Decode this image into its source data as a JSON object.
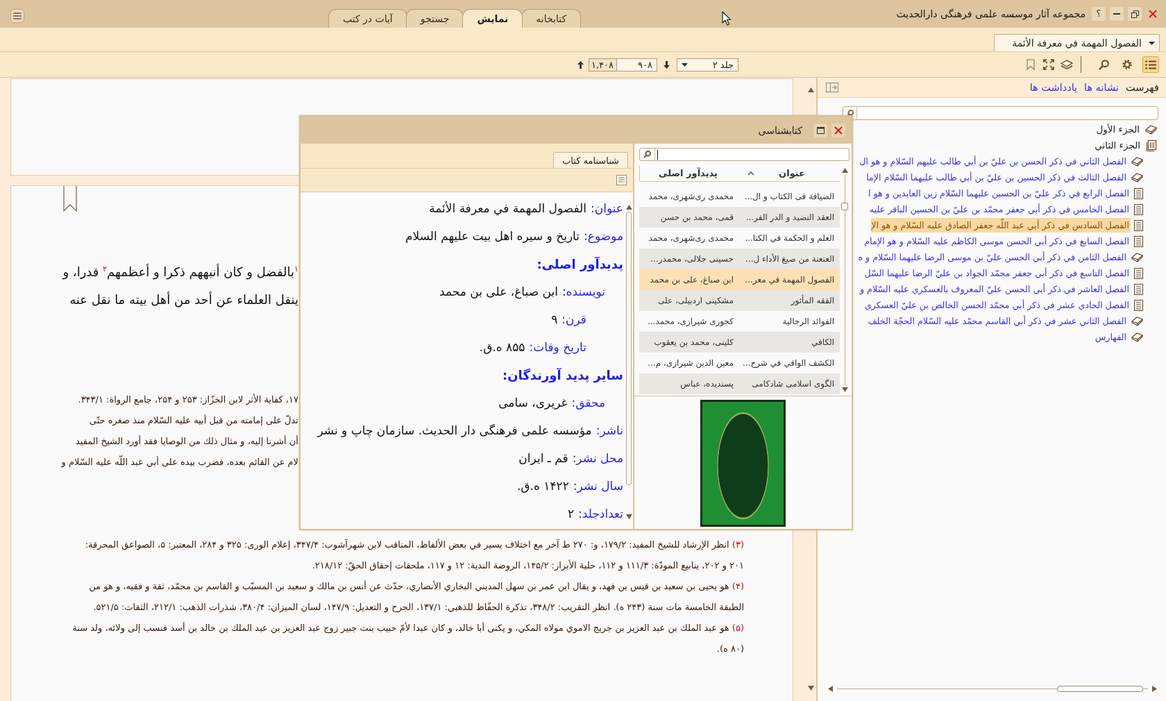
{
  "window": {
    "title": "مجموعه آثار موسسه علمی فرهنگی دارالحدیث",
    "help": "؟"
  },
  "ribbon_tabs": [
    {
      "label": "کتابخانه",
      "selected": false
    },
    {
      "label": "نمایش",
      "selected": true
    },
    {
      "label": "جستجو",
      "selected": false
    },
    {
      "label": "آیات در کتب",
      "selected": false
    }
  ],
  "book_selector": {
    "value": "الفصول المهمة في معرفة الأئمة"
  },
  "toolbar": {
    "tool_groups": [
      [
        {
          "kind": "contents",
          "on": true
        },
        {
          "kind": "settings",
          "on": false
        },
        {
          "kind": "search",
          "on": false
        }
      ],
      [
        {
          "kind": "books",
          "on": false
        },
        {
          "kind": "fullscreen",
          "on": false
        },
        {
          "kind": "bookmark",
          "on": false
        }
      ]
    ],
    "volume": "جلد ۲",
    "page": "۹۰۸",
    "page_count": "۱,۴۰۸"
  },
  "document": {
    "text_lines": [
      "$^{۱}$بالفضل و كان أنبههم ذكرا و أعظمهم$^{۲}$ قدرا، و",
      "ينقل العلماء عن أحد من أهل بيته ما نقل عنه"
    ],
    "covered_footnote_lines": [
      "۱۷، كفاية الأثر لابن الخزّاز: ۲۵۳ و ۲۵۴، جامع الرواة: ۳۴۳/۱.",
      "تدلّ على إمامته من قبل أبيه عليه السّلام منذ صغره حتّى",
      "أن أشرنا إليه، و مثال ذلك من الوصايا فقد أورد الشيخ المفيد",
      "لام عن القائم بعده، فضرب بيده على أبي عبد اللّه عليه السّلام و"
    ],
    "footnotes": [
      {
        "number": "(۳)",
        "text": "انظر الإرشاد للشيخ المفيد: ۱۷۹/۲، و: ۲۷۰ ط آخر مع اختلاف يسير في بعض الألفاظ، المناقب لابن شهرآشوب: ۳۴۷/۴، إعلام الورى: ۳۲۵ و ۲۸۴، المعتبر: ۵، الصواعق المحرقة: ۲۰۱ و ۲۰۲، ينابيع المودّة: ۱۱۱/۳ و ۱۱۲، حلية الأبرار: ۱۴۵/۲، الروضة الندية: ۱۲ و ۱۱۷، ملحقات إحقاق الحقّ: ۲۱۸/۱۲."
      },
      {
        "number": "(۴)",
        "text": "هو يحيى بن سعيد بن قيس بن فهد، و يقال ابن عمر بن سهل المديني البخاري الأنصاري، حدّث عن أنس بن مالك و سعيد بن المسيّب و القاسم بن محمّد، ثقة و فقيه، و هو من الطبقة الخامسة مات سنة (۲۴۳ ه). انظر التقريب: ۳۴۸/۲، تذكرة الحفّاظ للذهبي: ۱۳۷/۱، الجرح و التعديل: ۱۴۷/۹، لسان الميزان: ۳۸۰/۴، شذرات الذهب: ۲۱۲/۱، الثقات: ۵۲۱/۵."
      },
      {
        "number": "(۵)",
        "text": "هو عبد الملك بن عبد العزيز بن جريج الاموي مولاه المكي، و يكنى أبا خالد، و كان عبدا لأمّ حبيب بنت جبير زوج عبد العزيز بن عبد الملك بن خالد بن أسد فنسب إلى ولائه، ولد سنة (۸۰ ه)."
      }
    ]
  },
  "sidebar": {
    "tabs": [
      {
        "label": "فهرست",
        "selected": true
      },
      {
        "label": "نشانه ها",
        "selected": false
      },
      {
        "label": "یادداشت ها",
        "selected": false
      }
    ],
    "tree": [
      {
        "label": "الجزء الأول",
        "kind": "book",
        "expanded": false,
        "selected": false
      },
      {
        "label": "الجزء الثاني",
        "kind": "book",
        "expanded": true,
        "selected": false,
        "children": [
          {
            "label": "الفصل الثاني في ذكر الحسن بن عليّ بن أبي طالب عليهم السّلام و هو ال",
            "kind": "book",
            "expanded": false,
            "selected": false
          },
          {
            "label": "الفصل الثالث في ذكر الحسين بن عليّ بن أبي طالب عليهما السّلام الإما",
            "kind": "book",
            "expanded": false,
            "selected": false
          },
          {
            "label": "الفصل الرابع في ذكر عليّ بن الحسين عليهما السّلام زين العابدين و هو ا",
            "kind": "page",
            "selected": false
          },
          {
            "label": "الفصل الخامس في ذكر أبي جعفر محمّد بن عليّ بن الحسين الباقر عليه",
            "kind": "page",
            "selected": false
          },
          {
            "label": "الفصل السادس في ذكر أبي عبد اللّه جعفر الصادق عليه السّلام و هو الإ",
            "kind": "page",
            "selected": true
          },
          {
            "label": "الفصل السابع في ذكر أبي الحسن موسى الكاظم عليه السّلام و هو الإمام",
            "kind": "page",
            "selected": false
          },
          {
            "label": "الفصل الثامن في ذكر أبي الحسن عليّ بن موسى الرضا عليهما السّلام و ه",
            "kind": "book",
            "expanded": false,
            "selected": false
          },
          {
            "label": "الفصل التاسع في ذكر أبي جعفر محمّد الجواد بن عليّ الرضا عليهما السّل",
            "kind": "page",
            "selected": false
          },
          {
            "label": "الفصل العاشر في ذكر أبي الحسن عليّ المعروف بالعسكري عليه السّلام و",
            "kind": "page",
            "selected": false
          },
          {
            "label": "الفصل الحادي عشر في ذكر أبي محمّد الحسن الخالص بن عليّ العسكري",
            "kind": "page",
            "selected": false
          },
          {
            "label": "الفصل الثاني عشر في ذكر أبي القاسم محمّد عليه السّلام الحجّة الخلف",
            "kind": "book",
            "expanded": false,
            "selected": false
          },
          {
            "label": "الفهارس",
            "kind": "book",
            "expanded": false,
            "selected": false
          }
        ]
      }
    ]
  },
  "dialog": {
    "title": "کتابشناسی",
    "columns": [
      {
        "label": "عنوان",
        "sorted": true
      },
      {
        "label": "پدیدآور اصلی",
        "sorted": false
      }
    ],
    "rows": [
      {
        "cells": [
          "الضيافة فى الكتاب و ال...",
          "محمدی ری‌شهری، محمد"
        ],
        "selected": false
      },
      {
        "cells": [
          "العقد النضيد و الدر الفر...",
          "قمی، محمد بن حسن"
        ],
        "selected": false
      },
      {
        "cells": [
          "العلم و الحكمة في الكتا...",
          "محمدی ری‌شهری، محمد"
        ],
        "selected": false
      },
      {
        "cells": [
          "العنعنة من صيغ الأداء ل...",
          "حسینی جلالی، محمدر..."
        ],
        "selected": false
      },
      {
        "cells": [
          "الفصول المهمة في معر...",
          "ابن صباغ، علی بن محمد"
        ],
        "selected": true
      },
      {
        "cells": [
          "الفقه المأثور",
          "مشکینی اردبیلی، علی"
        ],
        "selected": false
      },
      {
        "cells": [
          "الفوائد الرجالية",
          "کجوری شیرازی، محمد..."
        ],
        "selected": false
      },
      {
        "cells": [
          "الكافي",
          "کلینی، محمد بن یعقوب"
        ],
        "selected": false
      },
      {
        "cells": [
          "الكشف الوافي في شرح...",
          "معین الدین شیرازی، م..."
        ],
        "selected": false
      },
      {
        "cells": [
          "الگوی اسلامی شادکامی",
          "پسندیده، عباس"
        ],
        "selected": false
      }
    ],
    "detail_tabs": [
      {
        "label": "شناسنامه کتاب",
        "selected": true
      }
    ],
    "details": [
      {
        "kind": "field",
        "label": "عنوان:",
        "value": "الفصول المهمة في معرفة الأئمة"
      },
      {
        "kind": "field",
        "label": "موضوع:",
        "value": "تاريخ و سيره اهل بيت عليهم السلام"
      },
      {
        "kind": "heading",
        "label": "پدیدآور اصلی:",
        "children": [
          {
            "kind": "field",
            "label": "نویسنده:",
            "value": "ابن صباغ، علی بن محمد",
            "children": [
              {
                "kind": "field",
                "label": "قرن:",
                "value": "۹"
              },
              {
                "kind": "field",
                "label": "تاریخ وفات:",
                "value": "۸۵۵ ه.ق."
              }
            ]
          }
        ]
      },
      {
        "kind": "heading",
        "label": "سایر پدید آورندگان:",
        "children": [
          {
            "kind": "field",
            "label": "محقق:",
            "value": "غریری، سامی"
          }
        ]
      },
      {
        "kind": "field",
        "label": "ناشر:",
        "value": "مؤسسه علمی فرهنگی دار الحدیث. سازمان چاپ و نشر"
      },
      {
        "kind": "field",
        "label": "محل نشر:",
        "value": "قم ـ ایران"
      },
      {
        "kind": "field",
        "label": "سال نشر:",
        "value": "۱۴۲۲ ه.ق."
      },
      {
        "kind": "field",
        "label": "تعدادجلد:",
        "value": "۲"
      }
    ]
  }
}
